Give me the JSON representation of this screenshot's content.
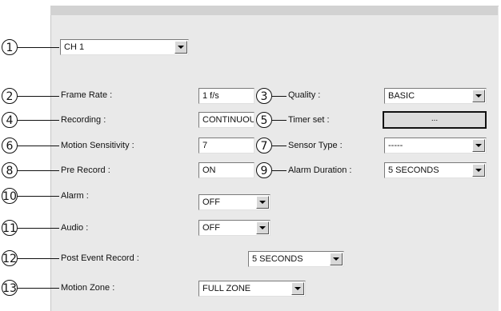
{
  "channel": {
    "value": "CH 1"
  },
  "callouts": [
    "1",
    "2",
    "3",
    "4",
    "5",
    "6",
    "7",
    "8",
    "9",
    "10",
    "11",
    "12",
    "13"
  ],
  "fields": {
    "frame_rate": {
      "label": "Frame Rate :",
      "value": "1 f/s"
    },
    "quality": {
      "label": "Quality :",
      "value": "BASIC"
    },
    "recording": {
      "label": "Recording :",
      "value": "CONTINUOUS"
    },
    "timer_set": {
      "label": "Timer set :",
      "button": "..."
    },
    "motion_sensitivity": {
      "label": "Motion Sensitivity :",
      "value": "7"
    },
    "sensor_type": {
      "label": "Sensor Type :",
      "value": "-----"
    },
    "pre_record": {
      "label": "Pre Record :",
      "value": "ON"
    },
    "alarm_duration": {
      "label": "Alarm Duration :",
      "value": "5 SECONDS"
    },
    "alarm": {
      "label": "Alarm :",
      "value": "OFF"
    },
    "audio": {
      "label": "Audio :",
      "value": "OFF"
    },
    "post_event_record": {
      "label": "Post Event Record :",
      "value": "5 SECONDS"
    },
    "motion_zone": {
      "label": "Motion Zone :",
      "value": "FULL ZONE"
    }
  }
}
